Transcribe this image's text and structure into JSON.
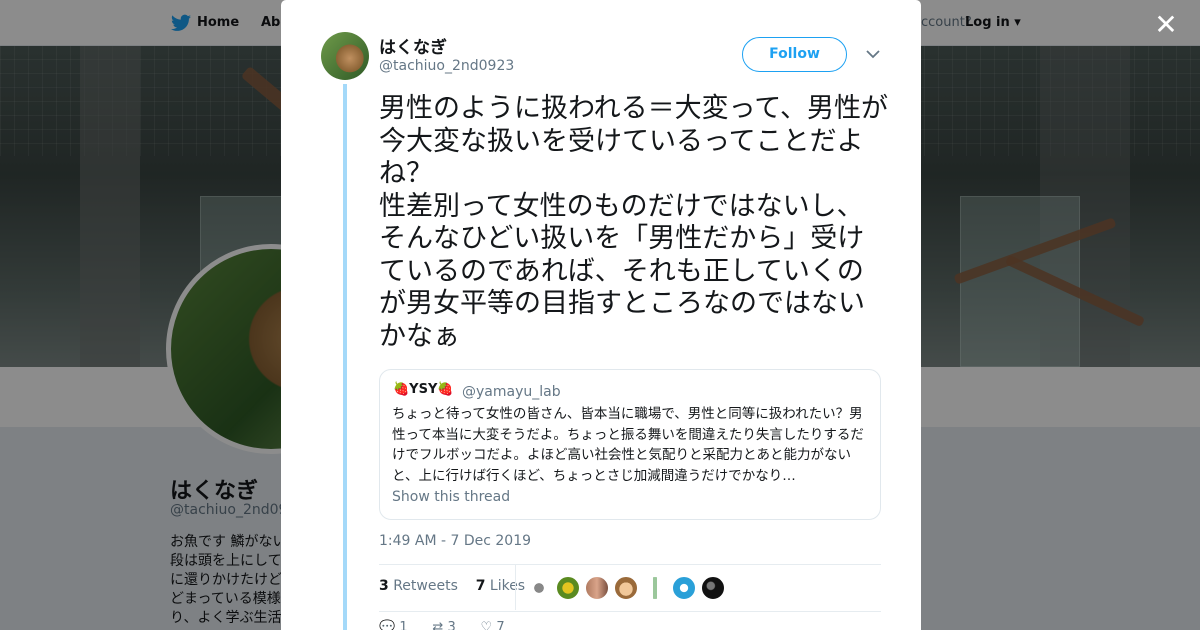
{
  "topbar": {
    "home_label": "Home",
    "about_label": "Abo",
    "account_prompt": "ccount?",
    "login_label": "Log in"
  },
  "profile": {
    "name": "はくなぎ",
    "handle": "@tachiuo_2nd092",
    "bio": "お魚です 鱗がない段は頭を上にしてに還りかけたけどどまっている模様り、よく学ぶ生活"
  },
  "tweet": {
    "author_name": "はくなぎ",
    "author_handle": "@tachiuo_2nd0923",
    "follow_label": "Follow",
    "text": "男性のように扱われる＝大変って、男性が今大変な扱いを受けているってことだよね？\n性差別って女性のものだけではないし、そんなひどい扱いを「男性だから」受けているのであれば、それも正していくのが男女平等の目指すところなのではないかなぁ",
    "timestamp": "1:49 AM - 7 Dec 2019",
    "retweets_count": "3",
    "retweets_label": "Retweets",
    "likes_count": "7",
    "likes_label": "Likes",
    "reply_count": "1",
    "retweet_action_count": "3",
    "like_action_count": "7"
  },
  "quote": {
    "name": "🍓YSY🍓",
    "handle": "@yamayu_lab",
    "text": "ちょっと待って女性の皆さん、皆本当に職場で、男性と同等に扱われたい？男性って本当に大変そうだよ。ちょっと振る舞いを間違えたり失言したりするだけでフルボッコだよ。よほど高い社会性と気配りと采配力とあと能力がないと、上に行けば行くほど、ちょっとさじ加減間違うだけでかなり…",
    "show_thread_label": "Show this thread"
  },
  "colors": {
    "accent": "#1da1f2",
    "thread_line": "#a4d9f9",
    "text_primary": "#14171a",
    "text_secondary": "#657786"
  },
  "icons": [
    "twitter-logo-icon",
    "close-icon",
    "chevron-down-icon",
    "reply-icon",
    "retweet-icon",
    "heart-icon"
  ]
}
